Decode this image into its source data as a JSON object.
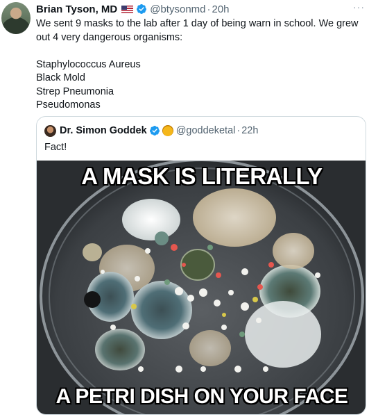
{
  "tweet": {
    "author_name": "Brian Tyson, MD",
    "author_handle": "@btysonmd",
    "separator": "·",
    "time": "20h",
    "more_label": "···",
    "text": "We sent 9 masks to the lab after 1 day of being warn in school.  We grew out 4 very dangerous organisms:",
    "organisms": [
      "Staphylococcus Aureus",
      "Black Mold",
      "Strep Pneumonia",
      "Pseudomonas"
    ],
    "icons": {
      "flag": "us-flag-icon",
      "verified": "verified-badge-icon"
    },
    "colors": {
      "verified": "#1d9bf0",
      "muted": "#536471"
    }
  },
  "quoted": {
    "author_name": "Dr. Simon Goddek",
    "author_handle": "@goddeketal",
    "separator": "·",
    "time": "22h",
    "text": "Fact!",
    "image": {
      "caption_top": "A MASK IS LITERALLY",
      "caption_bottom": "A PETRI DISH ON YOUR FACE"
    },
    "icons": {
      "verified": "verified-badge-icon",
      "emoji": "gold-coin-emoji-icon"
    }
  }
}
